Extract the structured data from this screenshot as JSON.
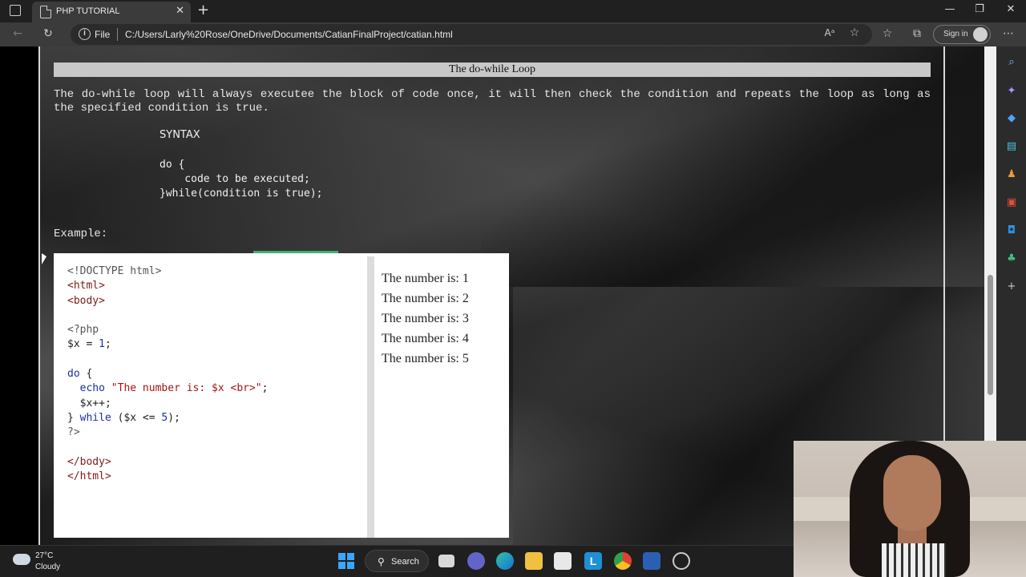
{
  "browser": {
    "tab_title": "PHP TUTORIAL",
    "tab_close": "✕",
    "new_tab": "+",
    "file_label": "File",
    "url": "C:/Users/Larly%20Rose/OneDrive/Documents/CatianFinalProject/catian.html",
    "sign_in": "Sign in",
    "window_controls": [
      "—",
      "❐",
      "✕"
    ]
  },
  "page": {
    "heading": "The do-while Loop",
    "description": "The do-while loop will always executee the block of code once, it will then check the condition and repeats the loop as long as the specified condition is true.",
    "syntax_title": "SYNTAX",
    "syntax_code": [
      "do {",
      "    code to be executed;",
      "}while(condition is true);"
    ],
    "example_label": "Example:",
    "code_lines": {
      "l1": "<!DOCTYPE html>",
      "l2": "<html>",
      "l3": "<body>",
      "l4": "<?php",
      "l5a": "$x = ",
      "l5b": "1",
      "l5c": ";",
      "l6a": "do",
      "l6b": " {",
      "l7a": "  ",
      "l7b": "echo",
      "l7c": " ",
      "l7d": "\"The number is: $x <br>\"",
      "l7e": ";",
      "l8": "  $x++;",
      "l9a": "} ",
      "l9b": "while",
      "l9c": " ($x <= ",
      "l9d": "5",
      "l9e": ");",
      "l10": "?>",
      "l11": "</body>",
      "l12": "</html>"
    },
    "output": [
      "The number is: 1",
      "The number is: 2",
      "The number is: 3",
      "The number is: 4",
      "The number is: 5"
    ]
  },
  "taskbar": {
    "temperature": "27°C",
    "condition": "Cloudy",
    "search_label": "Search"
  },
  "colors": {
    "heading_bg": "#c8c8c8",
    "code_tag": "#7a1a1a",
    "code_keyword": "#1a2fa0",
    "code_string": "#a31515"
  }
}
